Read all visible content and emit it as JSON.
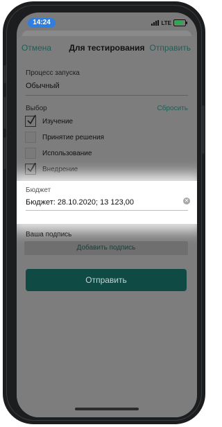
{
  "status_bar": {
    "time": "14:24",
    "network": "LTE"
  },
  "nav": {
    "cancel_label": "Отмена",
    "title": "Для тестирования",
    "send_label": "Отправить"
  },
  "launch": {
    "label": "Процесс запуска",
    "value": "Обычный"
  },
  "choice": {
    "label": "Выбор",
    "reset_label": "Сбросить",
    "options": [
      {
        "label": "Изучение",
        "checked": true
      },
      {
        "label": "Принятие решения",
        "checked": false
      },
      {
        "label": "Использование",
        "checked": false
      },
      {
        "label": "Внедрение",
        "checked": true
      }
    ]
  },
  "budget": {
    "label": "Бюджет",
    "value": "Бюджет: 28.10.2020; 13 123,00"
  },
  "signature": {
    "label": "Ваша подпись",
    "add_label": "Добавить подпись"
  },
  "submit_label": "Отправить",
  "colors": {
    "accent": "#1d5e56",
    "submit_bg": "#0f4a45",
    "time_pill": "#2f7ee0",
    "battery_fill": "#2fa84f"
  }
}
